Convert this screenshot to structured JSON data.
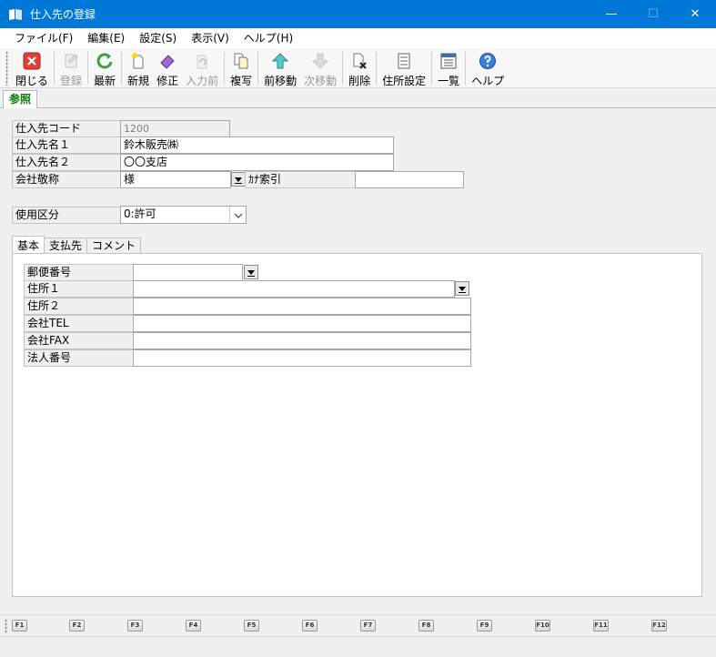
{
  "window": {
    "title": "仕入先の登録",
    "minimize": "—",
    "maximize": "☐",
    "close": "✕"
  },
  "menu": [
    "ファイル(F)",
    "編集(E)",
    "設定(S)",
    "表示(V)",
    "ヘルプ(H)"
  ],
  "toolbar": [
    {
      "label": "閉じる",
      "icon": "close-icon",
      "color": "#d9312b",
      "enabled": true
    },
    {
      "label": "登録",
      "icon": "save-icon",
      "color": "#7a7a7a",
      "enabled": false
    },
    {
      "label": "最新",
      "icon": "refresh-icon",
      "color": "#2e9a2e",
      "enabled": true
    },
    {
      "label": "新規",
      "icon": "new-document-icon",
      "color": "#e6b800",
      "enabled": true
    },
    {
      "label": "修正",
      "icon": "eraser-icon",
      "color": "#8a5cc4",
      "enabled": true
    },
    {
      "label": "入力前",
      "icon": "undo-icon",
      "color": "#7a7a7a",
      "enabled": false
    },
    {
      "label": "複写",
      "icon": "copy-icon",
      "color": "#e6a100",
      "enabled": true
    },
    {
      "label": "前移動",
      "icon": "arrow-up-icon",
      "color": "#2aa9a9",
      "enabled": true
    },
    {
      "label": "次移動",
      "icon": "arrow-down-icon",
      "color": "#7a7a7a",
      "enabled": false
    },
    {
      "label": "削除",
      "icon": "delete-document-icon",
      "color": "#333333",
      "enabled": true
    },
    {
      "label": "住所設定",
      "icon": "checklist-icon",
      "color": "#555555",
      "enabled": true
    },
    {
      "label": "一覧",
      "icon": "list-window-icon",
      "color": "#3a6fb0",
      "enabled": true
    },
    {
      "label": "ヘルプ",
      "icon": "help-icon",
      "color": "#2b6cc4",
      "enabled": true
    }
  ],
  "mode_tab": "参照",
  "form": {
    "code_label": "仕入先コード",
    "code_value": "1200",
    "name1_label": "仕入先名１",
    "name1_value": "鈴木販売㈱",
    "name2_label": "仕入先名２",
    "name2_value": "〇〇支店",
    "honorific_label": "会社敬称",
    "honorific_value": "様",
    "kana_label": "ｶﾅ索引",
    "kana_value": "",
    "usage_label": "使用区分",
    "usage_value": "0:許可"
  },
  "tabs": [
    "基本",
    "支払先",
    "コメント"
  ],
  "basic": [
    {
      "label": "郵便番号",
      "value": ""
    },
    {
      "label": "住所１",
      "value": ""
    },
    {
      "label": "住所２",
      "value": ""
    },
    {
      "label": "会社TEL",
      "value": ""
    },
    {
      "label": "会社FAX",
      "value": ""
    },
    {
      "label": "法人番号",
      "value": ""
    }
  ],
  "fkeys": [
    "F1",
    "F2",
    "F3",
    "F4",
    "F5",
    "F6",
    "F7",
    "F8",
    "F9",
    "F10",
    "F11",
    "F12"
  ]
}
